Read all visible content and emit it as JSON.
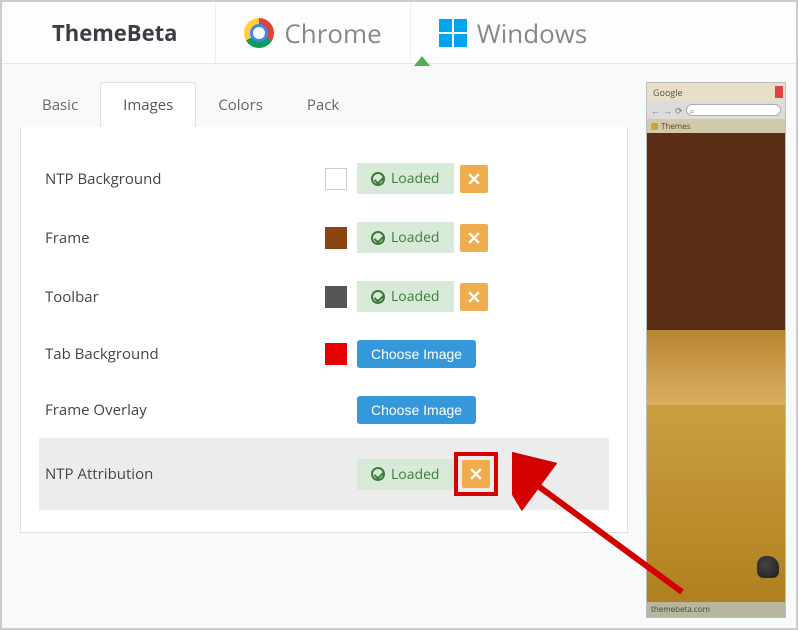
{
  "nav": {
    "brand": "ThemeBeta",
    "chrome_label": "Chrome",
    "windows_label": "Windows"
  },
  "tabs": {
    "basic": "Basic",
    "images": "Images",
    "colors": "Colors",
    "pack": "Pack"
  },
  "rows": {
    "ntp_bg": {
      "label": "NTP Background",
      "status": "Loaded"
    },
    "frame": {
      "label": "Frame",
      "status": "Loaded"
    },
    "toolbar": {
      "label": "Toolbar",
      "status": "Loaded"
    },
    "tab_bg": {
      "label": "Tab Background",
      "choose": "Choose Image"
    },
    "frame_overlay": {
      "label": "Frame Overlay",
      "choose": "Choose Image"
    },
    "ntp_attr": {
      "label": "NTP Attribution",
      "status": "Loaded"
    }
  },
  "preview": {
    "tab_title": "Google",
    "bookmark": "Themes",
    "omnibox_icon": "⌕",
    "attribution": "themebeta.com"
  }
}
